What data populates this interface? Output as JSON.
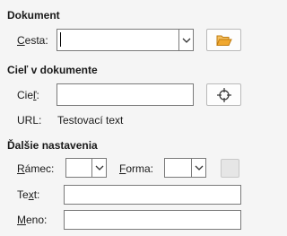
{
  "sections": {
    "document": {
      "title": "Dokument"
    },
    "target": {
      "title": "Cieľ v dokumente"
    },
    "more": {
      "title": "Ďalšie nastavenia"
    }
  },
  "document": {
    "path_label_first": "C",
    "path_label_rest": "esta:",
    "path_value": "",
    "open_button_icon": "folder-open-icon"
  },
  "target": {
    "target_label_first": "Cie",
    "target_label_u": "ľ",
    "target_label_rest": ":",
    "target_value": "",
    "target_button_icon": "target-crosshair-icon",
    "url_label": "URL:",
    "url_value": "Testovací text"
  },
  "more": {
    "frame_label_first": "R",
    "frame_label_rest": "ámec:",
    "frame_value": "",
    "form_label_first": "F",
    "form_label_rest": "orma:",
    "form_value": "",
    "events_button_icon": "events-button-icon",
    "text_label_first": "Te",
    "text_label_u": "x",
    "text_label_rest": "t:",
    "text_value": "",
    "name_label_first": "M",
    "name_label_rest": "eno:",
    "name_value": ""
  },
  "colors": {
    "folder": "#f0a830",
    "border": "#7a7a7a",
    "background": "#f5f5f5"
  }
}
